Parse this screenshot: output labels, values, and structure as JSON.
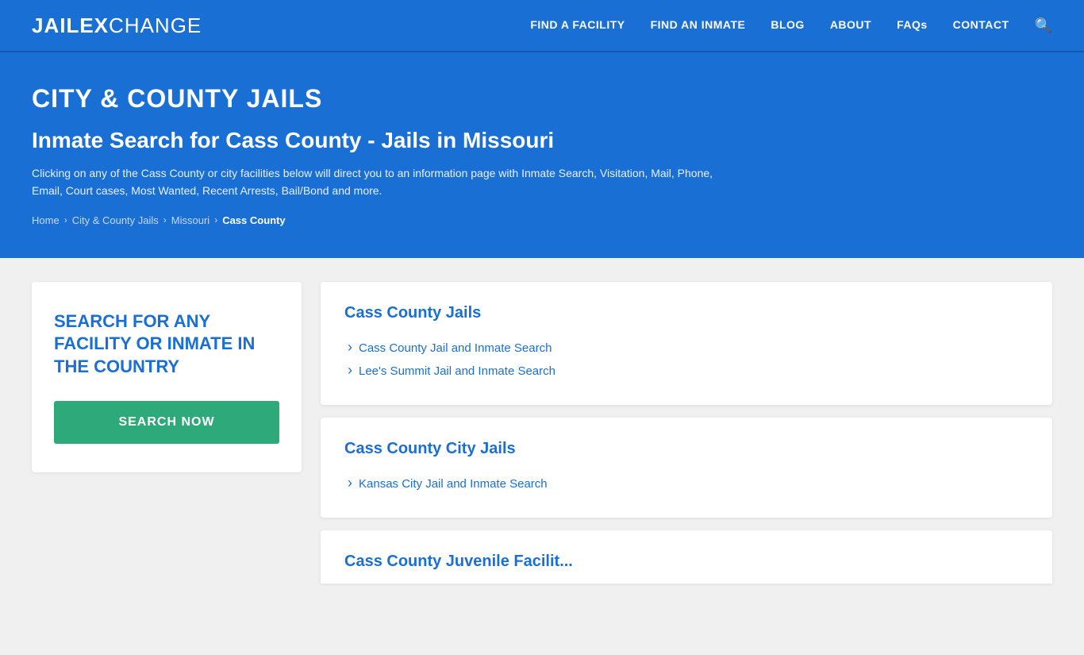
{
  "navbar": {
    "logo_jail": "JAIL",
    "logo_ex": "EX",
    "logo_change": "CHANGE",
    "nav_items": [
      {
        "label": "FIND A FACILITY",
        "id": "find-facility"
      },
      {
        "label": "FIND AN INMATE",
        "id": "find-inmate"
      },
      {
        "label": "BLOG",
        "id": "blog"
      },
      {
        "label": "ABOUT",
        "id": "about"
      },
      {
        "label": "FAQs",
        "id": "faqs"
      },
      {
        "label": "CONTACT",
        "id": "contact"
      }
    ]
  },
  "hero": {
    "category": "CITY & COUNTY JAILS",
    "title": "Inmate Search for Cass County - Jails in Missouri",
    "description": "Clicking on any of the Cass County or city facilities below will direct you to an information page with Inmate Search, Visitation, Mail, Phone, Email, Court cases, Most Wanted, Recent Arrests, Bail/Bond and more.",
    "breadcrumb": {
      "home": "Home",
      "city_county": "City & County Jails",
      "state": "Missouri",
      "current": "Cass County"
    }
  },
  "search_widget": {
    "title": "SEARCH FOR ANY FACILITY OR INMATE IN THE COUNTRY",
    "button_label": "SEARCH NOW"
  },
  "cards": [
    {
      "id": "cass-county-jails",
      "title": "Cass County Jails",
      "links": [
        {
          "label": "Cass County Jail and Inmate Search"
        },
        {
          "label": "Lee's Summit Jail and Inmate Search"
        }
      ]
    },
    {
      "id": "cass-county-city-jails",
      "title": "Cass County City Jails",
      "links": [
        {
          "label": "Kansas City Jail and Inmate Search"
        }
      ]
    },
    {
      "id": "cass-county-juvenile",
      "title": "Cass County Juvenile Facilit...",
      "links": []
    }
  ],
  "colors": {
    "primary_blue": "#1a6fd4",
    "green": "#2eaa7a",
    "bg_gray": "#f0f0f0"
  }
}
